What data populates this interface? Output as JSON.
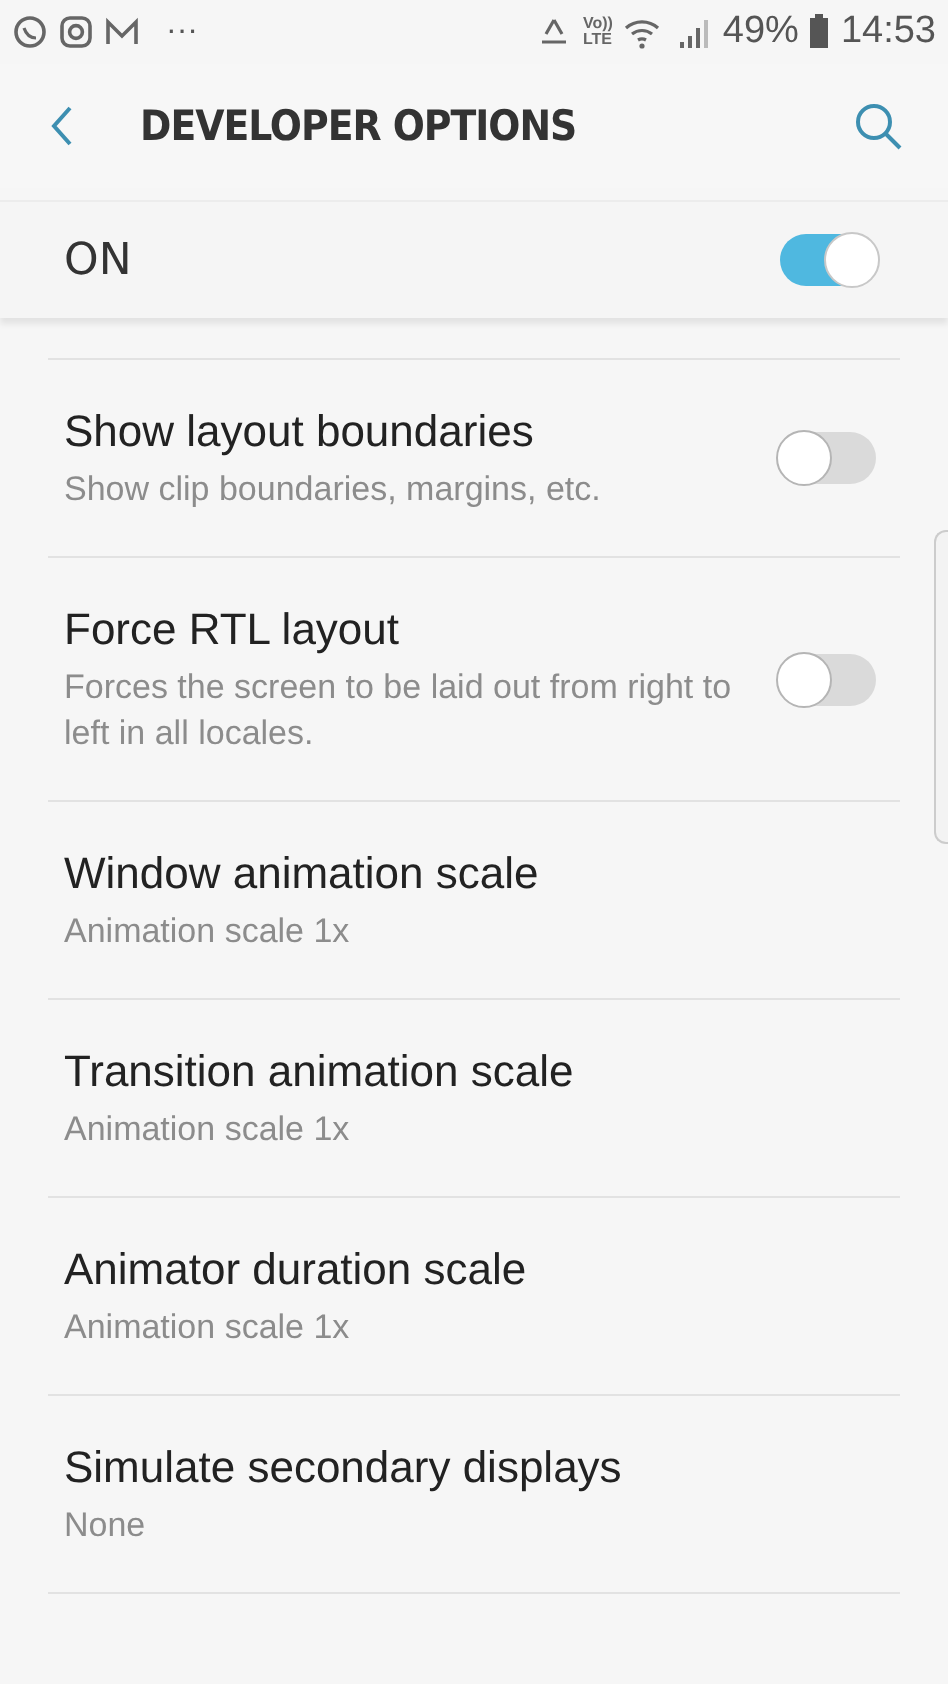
{
  "status_bar": {
    "more": "···",
    "volte": [
      "Vo))",
      "LTE"
    ],
    "battery": "49%",
    "time": "14:53"
  },
  "header": {
    "title": "DEVELOPER OPTIONS"
  },
  "master_switch": {
    "label": "ON",
    "on": true
  },
  "settings": [
    {
      "kind": "toggle",
      "title": "Show layout boundaries",
      "summary": "Show clip boundaries, margins, etc.",
      "on": false
    },
    {
      "kind": "toggle",
      "title": "Force RTL layout",
      "summary": "Forces the screen to be laid out from right to left in all locales.",
      "on": false
    },
    {
      "kind": "plain",
      "title": "Window animation scale",
      "summary": "Animation scale 1x"
    },
    {
      "kind": "plain",
      "title": "Transition animation scale",
      "summary": "Animation scale 1x"
    },
    {
      "kind": "plain",
      "title": "Animator duration scale",
      "summary": "Animation scale 1x"
    },
    {
      "kind": "plain",
      "title": "Simulate secondary displays",
      "summary": "None"
    }
  ]
}
